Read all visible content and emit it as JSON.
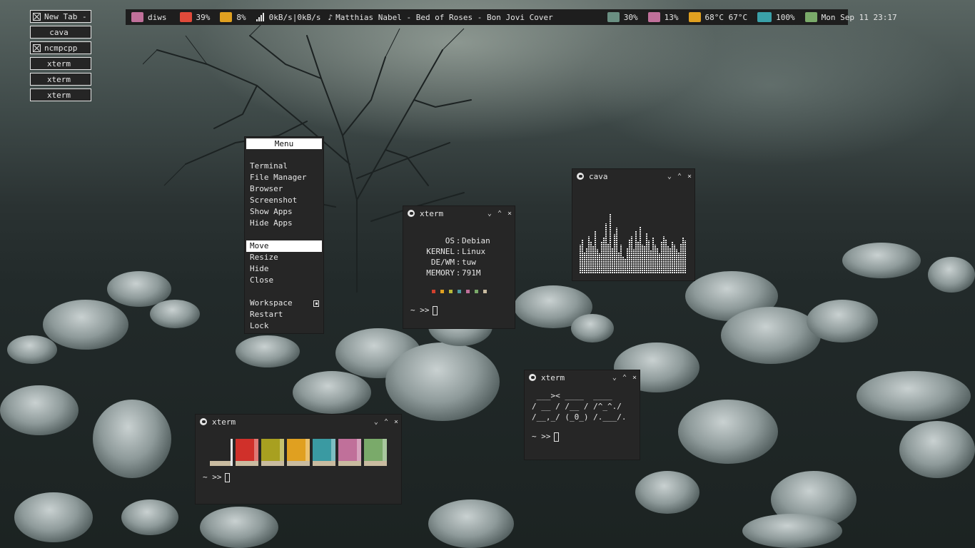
{
  "taglist": [
    {
      "label": "New Tab - B",
      "icon": "x-box-icon",
      "active": true
    },
    {
      "label": "cava",
      "icon": null
    },
    {
      "label": "ncmpcpp",
      "icon": "x-box-icon"
    },
    {
      "label": "xterm",
      "icon": null
    },
    {
      "label": "xterm",
      "icon": null
    },
    {
      "label": "xterm",
      "icon": null
    }
  ],
  "bar": {
    "user": {
      "icon": "user-icon",
      "value": "diws",
      "color": "#c0709a"
    },
    "disk": {
      "icon": "folder-icon",
      "value": "39%",
      "color": "#e04a3a"
    },
    "cpu": {
      "icon": "gauge-icon",
      "value": "8%",
      "color": "#e0a020"
    },
    "net": {
      "icon": "signal-icon",
      "value": "0kB/s|0kB/s"
    },
    "music": {
      "icon": "note-icon",
      "value": "Matthias Nabel - Bed of Roses - Bon Jovi Cover"
    },
    "brightness": {
      "icon": "brightness-icon",
      "value": "30%",
      "color": "#6a8f82"
    },
    "volume": {
      "icon": "speaker-icon",
      "value": "13%",
      "color": "#c0709a"
    },
    "temp": {
      "icon": "thermometer-icon",
      "value": "68°C 67°C",
      "color": "#e0a020"
    },
    "battery": {
      "icon": "battery-icon",
      "value": "100%",
      "color": "#3aa0a8"
    },
    "clock": {
      "icon": "calendar-icon",
      "value": "Mon Sep 11 23:17",
      "color": "#7aaa6a"
    }
  },
  "menu": {
    "title": "Menu",
    "group1": [
      "Terminal",
      "File Manager",
      "Browser",
      "Screenshot",
      "Show Apps",
      "Hide Apps"
    ],
    "group2": [
      "Move",
      "Resize",
      "Hide",
      "Close"
    ],
    "group3": [
      "Workspace",
      "Restart",
      "Lock"
    ],
    "selected": "Move"
  },
  "windows": {
    "xterm_info": {
      "title": "xterm",
      "rows": [
        {
          "k": "OS",
          "v": "Debian"
        },
        {
          "k": "KERNEL",
          "v": "Linux"
        },
        {
          "k": "DE/WM",
          "v": "tuw"
        },
        {
          "k": "MEMORY",
          "v": "791M"
        }
      ],
      "prompt": "~ >>",
      "dot_colors": [
        "#d0402e",
        "#e0a020",
        "#b7b83a",
        "#4a9aa0",
        "#c0709a",
        "#7aaa6a",
        "#c9bba0"
      ]
    },
    "cava": {
      "title": "cava"
    },
    "xterm_ascii": {
      "title": "xterm",
      "art": " ___>< ____  ____\n/ __ / /__ / /^_^./\n/__,_/ (_0_) /.___/.",
      "prompt": "~ >>"
    },
    "xterm_colors": {
      "title": "xterm",
      "prompt": "~ >>",
      "swatches": [
        "#d0302a",
        "#a8a020",
        "#e0a020",
        "#3a9aa2",
        "#c0709a",
        "#7aaa6a"
      ]
    }
  },
  "window_controls": {
    "min": "⌄",
    "max": "⌃",
    "close": "×"
  }
}
